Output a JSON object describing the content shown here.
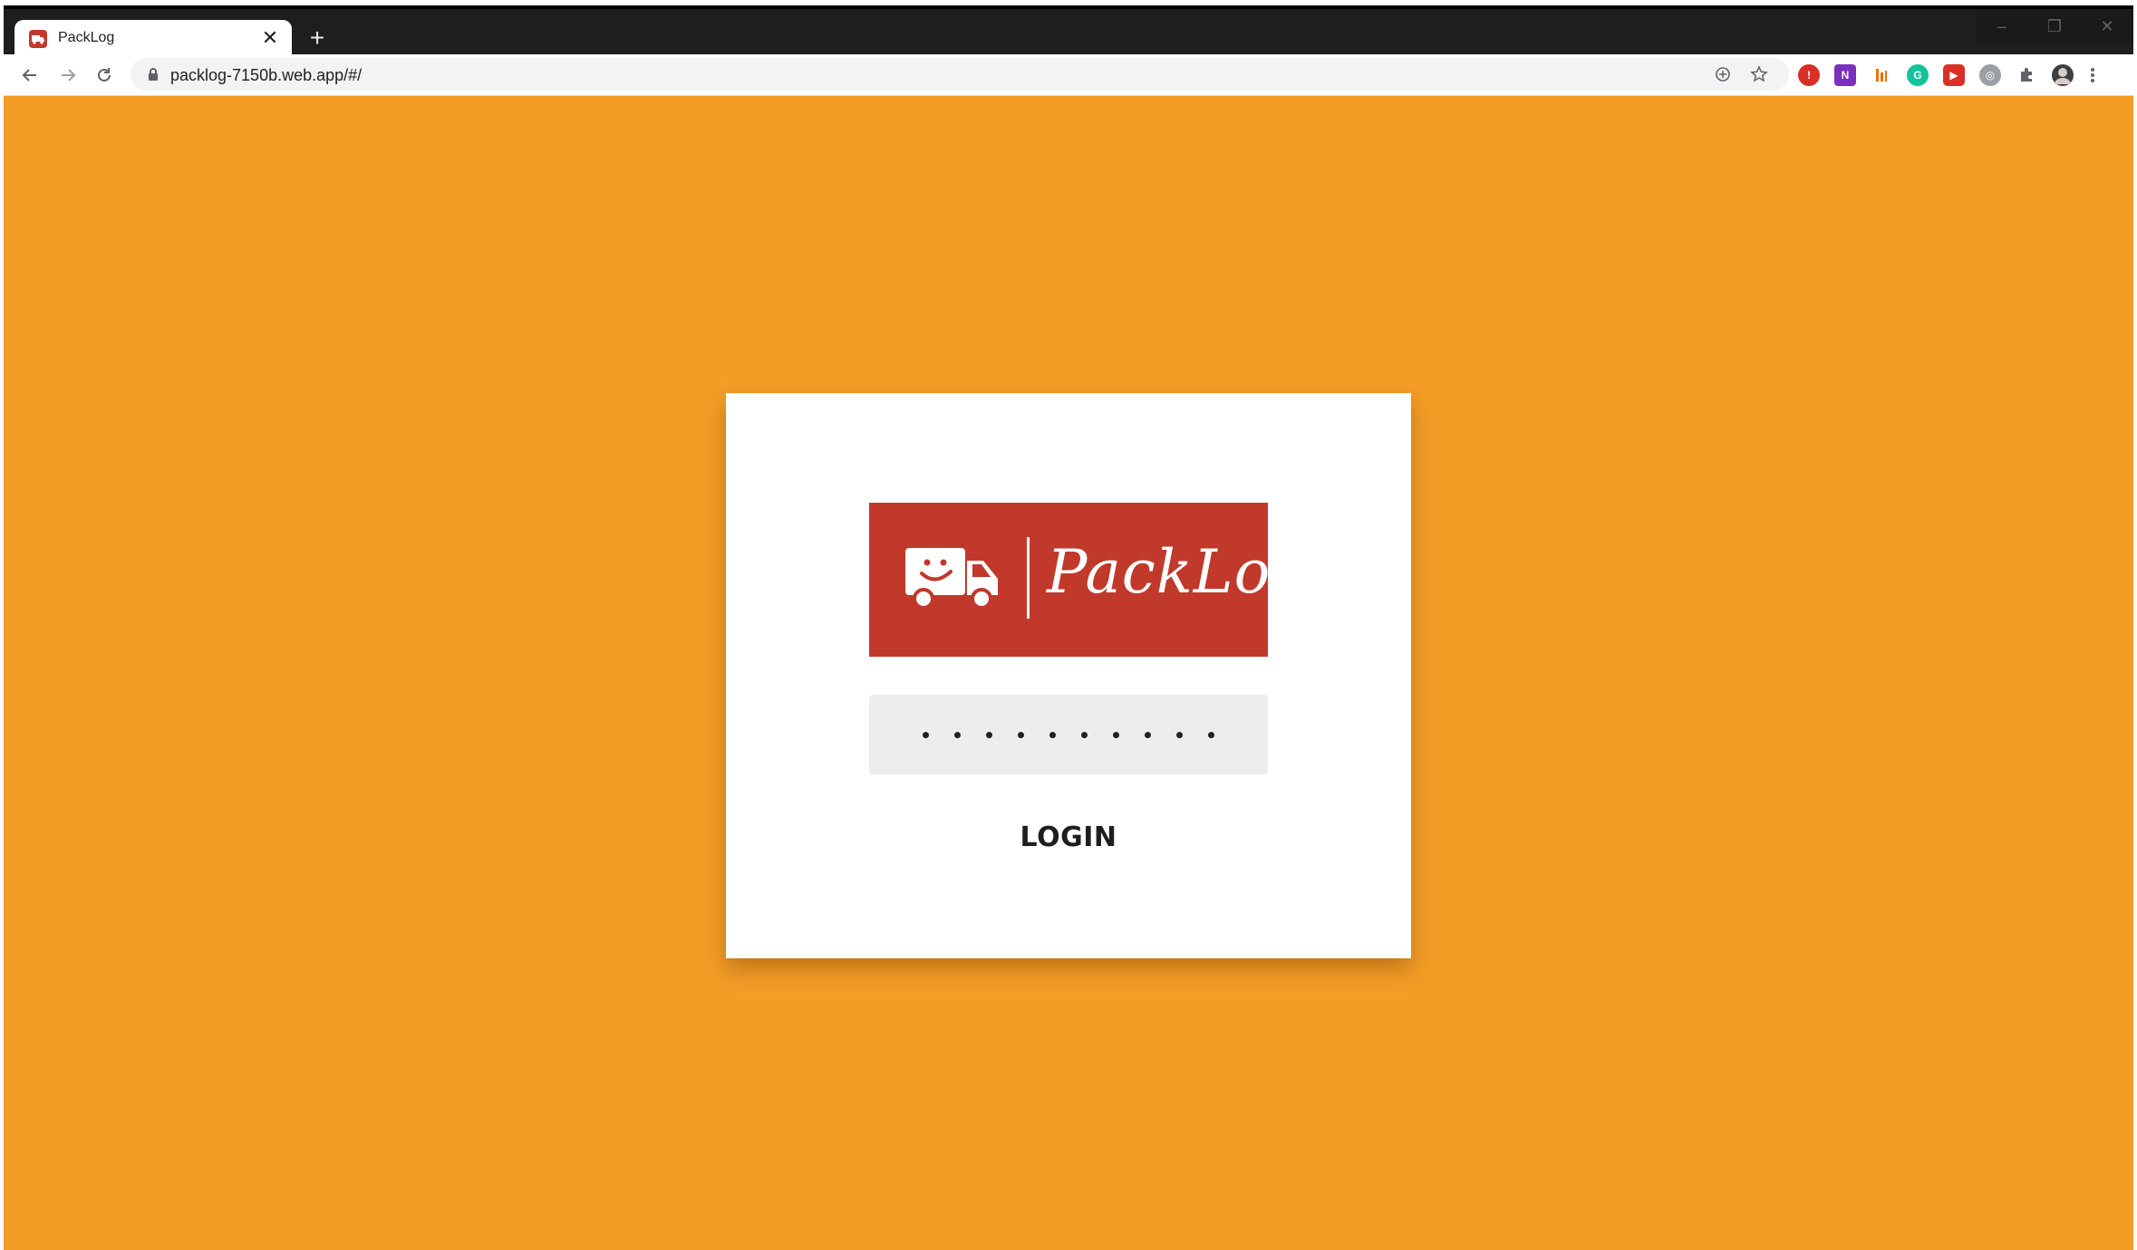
{
  "browser": {
    "tab_title": "PackLog",
    "new_tab_label": "+",
    "tab_close_label": "✕",
    "url": "packlog-7150b.web.app/#/",
    "window_controls": [
      "–",
      "❐",
      "✕"
    ]
  },
  "login": {
    "logo_text": "PackLog",
    "password_value": "••••••••••",
    "password_dot_count": 10,
    "button_label": "LOGIN"
  },
  "colors": {
    "page_background": "#f39d27",
    "card_background": "#ffffff",
    "logo_background": "#c0392b",
    "input_background": "#ededed"
  },
  "icons": {
    "back": "arrow-left-icon",
    "forward": "arrow-right-icon",
    "reload": "reload-icon",
    "lock": "lock-icon",
    "add_to_page": "plus-circle-icon",
    "bookmark": "star-icon",
    "extensions": [
      "stop-sign-icon",
      "onenote-icon",
      "bars-icon",
      "grammarly-icon",
      "media-icon",
      "globe-icon",
      "puzzle-icon",
      "avatar"
    ],
    "menu": "kebab-menu-icon",
    "logo_mark": "smiling-truck-icon"
  }
}
